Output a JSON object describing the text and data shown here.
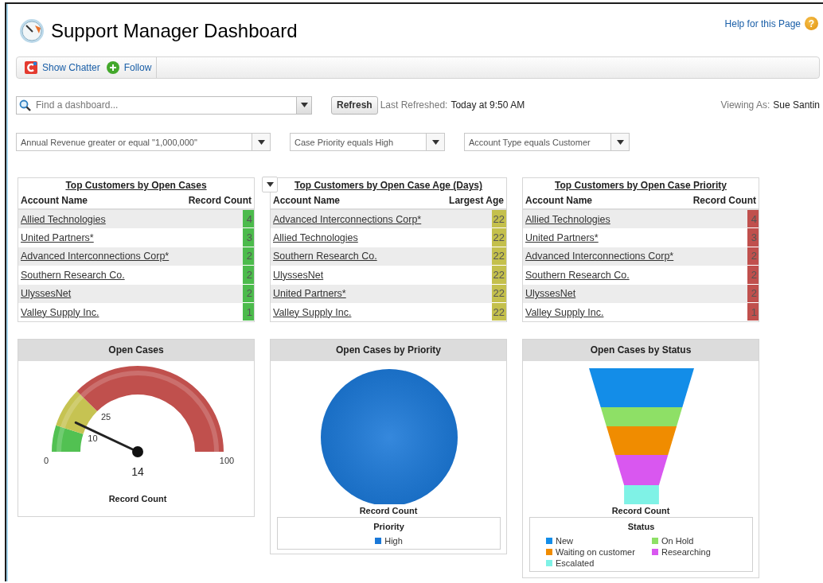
{
  "header": {
    "title": "Support Manager Dashboard",
    "help_link": "Help for this Page",
    "help_icon": "?"
  },
  "toolbar": {
    "items": [
      {
        "label": "Show Chatter",
        "kind": "chatter"
      },
      {
        "label": "Follow",
        "kind": "follow"
      }
    ]
  },
  "search": {
    "placeholder": "Find a dashboard..."
  },
  "refresh": {
    "button": "Refresh",
    "label": "Last Refreshed:",
    "value": "Today at 9:50 AM"
  },
  "viewing_as": {
    "label": "Viewing As:",
    "value": "Sue Santin"
  },
  "filters": [
    {
      "value": "Annual Revenue greater or equal \"1,000,000\""
    },
    {
      "value": "Case Priority equals High"
    },
    {
      "value": "Account Type equals Customer"
    }
  ],
  "tables": [
    {
      "title": "Top Customers by Open Cases",
      "color": "#4cbb4c",
      "columns": [
        "Account Name",
        "Record Count"
      ],
      "rows": [
        {
          "name": "Allied Technologies",
          "value": "4"
        },
        {
          "name": "United Partners*",
          "value": "3"
        },
        {
          "name": "Advanced Interconnections Corp*",
          "value": "2"
        },
        {
          "name": "Southern Research Co.",
          "value": "2"
        },
        {
          "name": "UlyssesNet",
          "value": "2"
        },
        {
          "name": "Valley Supply Inc.",
          "value": "1"
        }
      ]
    },
    {
      "title": "Top Customers by Open Case Age (Days)",
      "color": "#c4c04c",
      "columns": [
        "Account Name",
        "Largest Age"
      ],
      "rows": [
        {
          "name": "Advanced Interconnections Corp*",
          "value": "22"
        },
        {
          "name": "Allied Technologies",
          "value": "22"
        },
        {
          "name": "Southern Research Co.",
          "value": "22"
        },
        {
          "name": "UlyssesNet",
          "value": "22"
        },
        {
          "name": "United Partners*",
          "value": "22"
        },
        {
          "name": "Valley Supply Inc.",
          "value": "22"
        }
      ]
    },
    {
      "title": "Top Customers by Open Case Priority",
      "color": "#c0504d",
      "columns": [
        "Account Name",
        "Record Count"
      ],
      "rows": [
        {
          "name": "Allied Technologies",
          "value": "4"
        },
        {
          "name": "United Partners*",
          "value": "3"
        },
        {
          "name": "Advanced Interconnections Corp*",
          "value": "2"
        },
        {
          "name": "Southern Research Co.",
          "value": "2"
        },
        {
          "name": "UlyssesNet",
          "value": "2"
        },
        {
          "name": "Valley Supply Inc.",
          "value": "1"
        }
      ]
    }
  ],
  "gauge": {
    "title": "Open Cases",
    "min": "0",
    "max": "100",
    "value": "14",
    "label": "Record Count",
    "bands": [
      {
        "color": "#52c152"
      },
      {
        "start": "10",
        "color": "#c6c352"
      },
      {
        "start": "25",
        "color": "#c0504d"
      }
    ]
  },
  "pie": {
    "title": "Open Cases by Priority",
    "label": "Record Count",
    "legend_title": "Priority",
    "legend": [
      {
        "label": "High",
        "color": "#1a78d8"
      }
    ]
  },
  "funnel": {
    "title": "Open Cases by Status",
    "label": "Record Count",
    "legend_title": "Status",
    "legend": [
      {
        "label": "New",
        "color": "#138de8"
      },
      {
        "label": "On Hold",
        "color": "#8ee066"
      },
      {
        "label": "Waiting on customer",
        "color": "#f08c00"
      },
      {
        "label": "Researching",
        "color": "#d957f0"
      },
      {
        "label": "Escalated",
        "color": "#7ff2e6"
      }
    ]
  }
}
